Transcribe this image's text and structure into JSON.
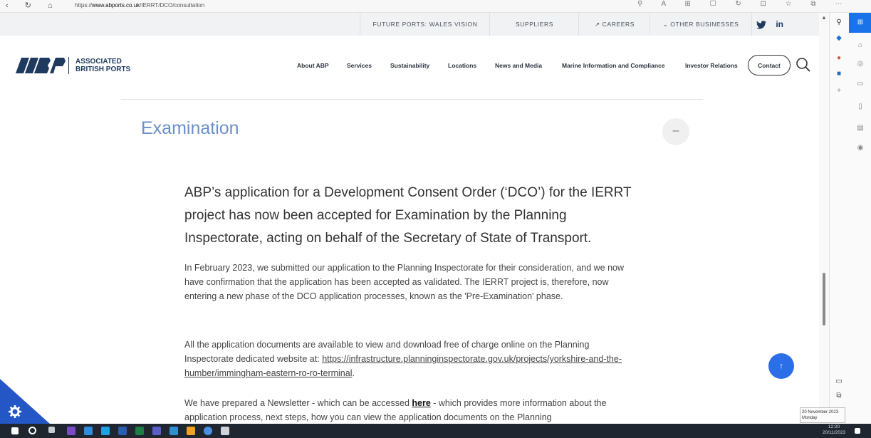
{
  "browser": {
    "url_prefix": "https://",
    "url_host": "www.abports.co.uk",
    "url_path": "/IERRT/DCO/consultation"
  },
  "utility_bar": {
    "items": [
      "FUTURE PORTS: WALES VISION",
      "SUPPLIERS",
      "↗ CAREERS",
      "⌄ OTHER BUSINESSES"
    ],
    "social": [
      "twitter-icon",
      "linkedin-icon"
    ]
  },
  "brand": {
    "line1": "ASSOCIATED",
    "line2": "BRITISH PORTS",
    "color": "#1e3a5f"
  },
  "nav": {
    "items": [
      "About ABP",
      "Services",
      "Sustainability",
      "Locations",
      "News and Media",
      "Marine Information and Compliance",
      "Investor Relations"
    ],
    "contact": "Contact"
  },
  "section": {
    "title": "Examination",
    "collapse_symbol": "–",
    "title_color": "#6b8fc9"
  },
  "content": {
    "lead": "ABP’s application for a Development Consent Order (‘DCO’) for the IERRT project has now been accepted for Examination by the Planning Inspectorate, acting on behalf of the Secretary of State of Transport.",
    "p1": "In February 2023, we submitted our application to the Planning Inspectorate for their consideration, and we now have confirmation that the application has been accepted as validated. The IERRT project is, therefore, now entering a new phase of the DCO application processes, known as the 'Pre-Examination' phase.",
    "p2_before": "All the application documents are available to view and download free of charge online on the Planning Inspectorate dedicated website at: ",
    "p2_link": "https://infrastructure.planninginspectorate.gov.uk/projects/yorkshire-and-the-humber/immingham-eastern-ro-ro-terminal",
    "p2_after": ".",
    "p3_before": "We have prepared a Newsletter - which can be accessed ",
    "p3_link": "here",
    "p3_after": " - which provides more information about the application process, next steps, how you can view the application documents on the Planning"
  },
  "floating": {
    "scroll_top": "↑"
  },
  "tooltip": {
    "date": "20 November 2023",
    "day": "Monday"
  },
  "taskbar": {
    "time": "12:20",
    "date": "20/11/2023"
  },
  "colors": {
    "accent_blue": "#2b6ee8",
    "edge_blue": "#1a73e8"
  }
}
